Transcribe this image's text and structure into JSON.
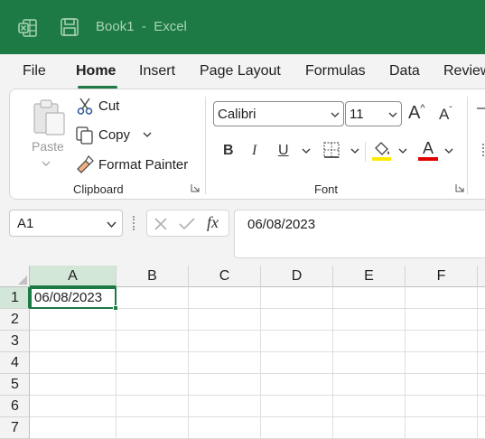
{
  "titlebar": {
    "title": "Book1  -  Excel",
    "logo_icon": "excel-logo-icon",
    "save_icon": "save-icon"
  },
  "tabs": [
    "File",
    "Home",
    "Insert",
    "Page Layout",
    "Formulas",
    "Data",
    "Review"
  ],
  "active_tab": "Home",
  "clipboard": {
    "paste_label": "Paste",
    "cut_label": "Cut",
    "copy_label": "Copy",
    "format_painter_label": "Format Painter",
    "group_label": "Clipboard"
  },
  "font": {
    "family": "Calibri",
    "size": "11",
    "bold": "B",
    "italic": "I",
    "underline": "U",
    "grow_font": "A",
    "shrink_font": "A",
    "font_color_glyph": "A",
    "group_label": "Font",
    "highlight_color": "#ffeb00",
    "font_color": "#e00000"
  },
  "formula_bar": {
    "name_box": "A1",
    "fx_label": "fx",
    "formula_value": "06/08/2023"
  },
  "grid": {
    "columns": [
      "A",
      "B",
      "C",
      "D",
      "E",
      "F"
    ],
    "rows": [
      "1",
      "2",
      "3",
      "4",
      "5",
      "6",
      "7"
    ],
    "cells": {
      "A1": "06/08/2023"
    }
  },
  "colors": {
    "accent": "#1e7a44"
  }
}
